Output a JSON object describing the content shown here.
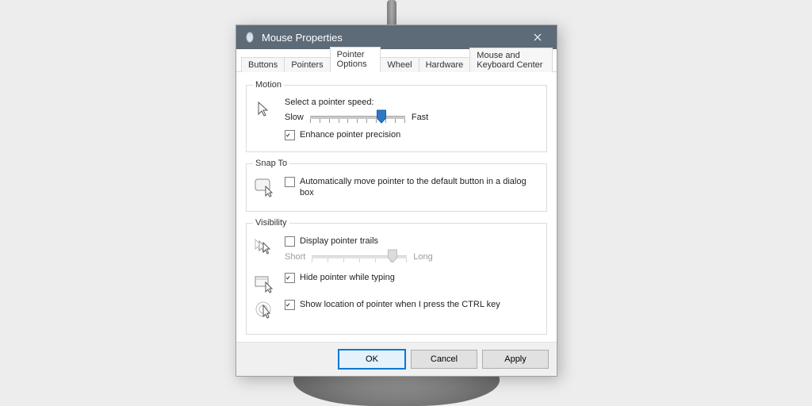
{
  "window": {
    "title": "Mouse Properties"
  },
  "tabs": {
    "t0": "Buttons",
    "t1": "Pointers",
    "t2": "Pointer Options",
    "t3": "Wheel",
    "t4": "Hardware",
    "t5": "Mouse and Keyboard Center",
    "active_index": 2
  },
  "motion": {
    "legend": "Motion",
    "select_label": "Select a pointer speed:",
    "slow": "Slow",
    "fast": "Fast",
    "speed_percent": 75,
    "enhance_label": "Enhance pointer precision",
    "enhance_checked": true
  },
  "snap": {
    "legend": "Snap To",
    "auto_label": "Automatically move pointer to the default button in a dialog box",
    "auto_checked": false
  },
  "visibility": {
    "legend": "Visibility",
    "trails_label": "Display pointer trails",
    "trails_checked": false,
    "short": "Short",
    "long": "Long",
    "trail_percent": 85,
    "hide_label": "Hide pointer while typing",
    "hide_checked": true,
    "ctrl_label": "Show location of pointer when I press the CTRL key",
    "ctrl_checked": true
  },
  "buttons": {
    "ok": "OK",
    "cancel": "Cancel",
    "apply": "Apply"
  }
}
